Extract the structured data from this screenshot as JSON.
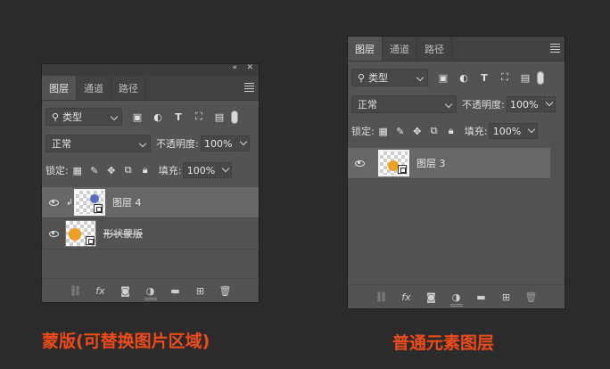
{
  "tabs": [
    "图层",
    "通道",
    "路径"
  ],
  "filter": {
    "kind_label": "类型"
  },
  "filter_icons": [
    "image-filter-icon",
    "adjustment-filter-icon",
    "type-filter-icon",
    "shape-filter-icon",
    "smart-object-filter-icon"
  ],
  "blend_mode": "正常",
  "opacity_label": "不透明度:",
  "opacity_value": "100%",
  "lock_label": "锁定:",
  "fill_label": "填充:",
  "fill_value": "100%",
  "panel_left": {
    "layers": [
      {
        "name": "图层 4",
        "selected": true,
        "clipped": true
      },
      {
        "name": "形状蒙版",
        "selected": false,
        "clipped": false
      }
    ]
  },
  "panel_right": {
    "layers": [
      {
        "name": "图层 3",
        "selected": true
      }
    ]
  },
  "bottom_icons": [
    "link-icon",
    "fx-icon",
    "mask-icon",
    "adjustment-icon",
    "folder-icon",
    "new-layer-icon",
    "trash-icon"
  ],
  "captions": {
    "left": "蒙版(可替换图片区域)",
    "right": "普通元素图层"
  },
  "accent_color": "#f04a18"
}
